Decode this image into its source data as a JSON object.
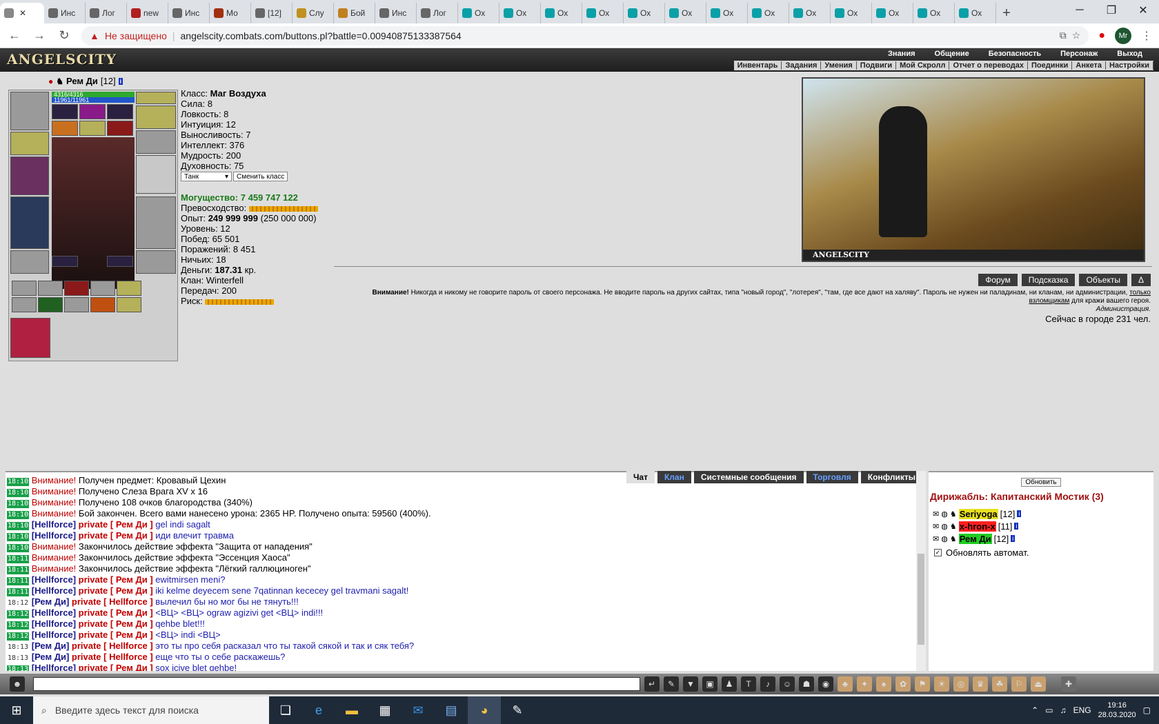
{
  "browser": {
    "tabs": [
      {
        "title": "",
        "color": "#888888",
        "active": true
      },
      {
        "title": "Инс",
        "color": "#666666"
      },
      {
        "title": "Лог",
        "color": "#666666"
      },
      {
        "title": "new",
        "color": "#b02020"
      },
      {
        "title": "Инс",
        "color": "#666666"
      },
      {
        "title": "Мо",
        "color": "#a03010"
      },
      {
        "title": "[12]",
        "color": "#666666"
      },
      {
        "title": "Слу",
        "color": "#c09020"
      },
      {
        "title": "Бой",
        "color": "#c08020"
      },
      {
        "title": "Инс",
        "color": "#666666"
      },
      {
        "title": "Лог",
        "color": "#666666"
      },
      {
        "title": "Ох",
        "color": "#0aa0a8"
      },
      {
        "title": "Ох",
        "color": "#0aa0a8"
      },
      {
        "title": "Ох",
        "color": "#0aa0a8"
      },
      {
        "title": "Ох",
        "color": "#0aa0a8"
      },
      {
        "title": "Ох",
        "color": "#0aa0a8"
      },
      {
        "title": "Ох",
        "color": "#0aa0a8"
      },
      {
        "title": "Ох",
        "color": "#0aa0a8"
      },
      {
        "title": "Ох",
        "color": "#0aa0a8"
      },
      {
        "title": "Ох",
        "color": "#0aa0a8"
      },
      {
        "title": "Ох",
        "color": "#0aa0a8"
      },
      {
        "title": "Ох",
        "color": "#0aa0a8"
      },
      {
        "title": "Ох",
        "color": "#0aa0a8"
      },
      {
        "title": "Ох",
        "color": "#0aa0a8"
      }
    ],
    "security_label": "Не защищено",
    "url": "angelscity.combats.com/buttons.pl?battle=0.00940875133387564",
    "profile_initials": "Mr"
  },
  "game": {
    "logo": "ANGELSCITY",
    "top_menu": [
      "Знания",
      "Общение",
      "Безопасность",
      "Персонаж",
      "Выход"
    ],
    "sub_menu": [
      "Инвентарь",
      "Задания",
      "Умения",
      "Подвиги",
      "Мой Скролл",
      "Отчет о переводах",
      "Поединки",
      "Анкета",
      "Настройки"
    ]
  },
  "character": {
    "name": "Рем Ди",
    "level": "[12]",
    "hp": "4316/4316",
    "mp": "11961/11961",
    "class_label": "Класс:",
    "class_value": "Маг Воздуха",
    "stats": [
      "Сила: 8",
      "Ловкость: 8",
      "Интуиция: 12",
      "Выносливость: 7",
      "Интеллект: 376",
      "Мудрость: 200",
      "Духовность: 75"
    ],
    "role_select": "Танк",
    "change_class": "Сменить класс",
    "power": "Могущество: 7 459 747 122",
    "superiority": "Превосходство:",
    "exp_label": "Опыт:",
    "exp_value": "249 999 999",
    "exp_next": "(250 000 000)",
    "info": [
      "Уровень: 12",
      "Побед: 65 501",
      "Поражений: 8 451",
      "Ничьих: 18"
    ],
    "money_label": "Деньги:",
    "money_value": "187.31",
    "money_unit": "кр.",
    "clan": "Клан: Winterfell",
    "transfers": "Передач: 200",
    "risk": "Риск:"
  },
  "scene": {
    "label": "ANGELSCITY"
  },
  "right_buttons": [
    "Форум",
    "Подсказка",
    "Объекты",
    "Δ"
  ],
  "notice": {
    "bold": "Внимание!",
    "text1": " Никогда и никому не говорите пароль от своего персонажа. Не вводите пароль на других сайтах, типа \"новый город\", \"лотерея\", \"там, где все дают на халяву\". Пароль не нужен ни паладинам, ни кланам, ни администрации, ",
    "link": "только взломщикам",
    "text2": " для кражи вашего героя.",
    "sign": "Администрация."
  },
  "online": "Сейчас в городе 231 чел.",
  "chat_tabs": [
    "Чат",
    "Клан",
    "Системные сообщения",
    "Торговля",
    "Конфликты"
  ],
  "chat": [
    {
      "time": "18:10",
      "type": "att",
      "lead": "Внимание!",
      "text": " Получен предмет: Кровавый Цехин"
    },
    {
      "time": "18:10",
      "type": "att",
      "lead": "Внимание!",
      "text": " Получено Слеза Врага XV x 16"
    },
    {
      "time": "18:10",
      "type": "att",
      "lead": "Внимание!",
      "text": " Получено 108 очков благородства (340%)"
    },
    {
      "time": "18:10",
      "type": "att",
      "lead": "Внимание!",
      "text": " Бой закончен. Всего вами нанесено урона: 2365 HP. Получено опыта: 59560 (400%)."
    },
    {
      "time": "18:10",
      "type": "priv",
      "from": "[Hellforce]",
      "to": "private [ Рем Ди ]",
      "text": "gel indi sagalt"
    },
    {
      "time": "18:10",
      "type": "priv",
      "from": "[Hellforce]",
      "to": "private [ Рем Ди ]",
      "text": "иди влечит травма"
    },
    {
      "time": "18:10",
      "type": "att",
      "lead": "Внимание!",
      "text": " Закончилось действие эффекта \"Защита от нападения\""
    },
    {
      "time": "18:11",
      "type": "att",
      "lead": "Внимание!",
      "text": " Закончилось действие эффекта \"Эссенция Хаоса\""
    },
    {
      "time": "18:11",
      "type": "att",
      "lead": "Внимание!",
      "text": " Закончилось действие эффекта \"Лёгкий галлюциноген\""
    },
    {
      "time": "18:11",
      "type": "priv",
      "from": "[Hellforce]",
      "to": "private [ Рем Ди ]",
      "text": "ewitmirsen meni?"
    },
    {
      "time": "18:11",
      "type": "priv",
      "from": "[Hellforce]",
      "to": "private [ Рем Ди ]",
      "text": "iki kelme deyecem sene 7qatinnan kececey gel travmani sagalt!"
    },
    {
      "time": "18:12",
      "type": "privw",
      "from": "[Рем Ди]",
      "to": "private [ Hellforce ]",
      "text": "вылечил бы но мог бы не тянуть!!!"
    },
    {
      "time": "18:12",
      "type": "priv",
      "from": "[Hellforce]",
      "to": "private [ Рем Ди ]",
      "text": "<ВЦ> <ВЦ> ograw agizivi get <ВЦ> indi!!!"
    },
    {
      "time": "18:12",
      "type": "priv",
      "from": "[Hellforce]",
      "to": "private [ Рем Ди ]",
      "text": "qehbe blet!!!"
    },
    {
      "time": "18:12",
      "type": "priv",
      "from": "[Hellforce]",
      "to": "private [ Рем Ди ]",
      "text": "<ВЦ> indi <ВЦ>"
    },
    {
      "time": "18:13",
      "type": "privw",
      "from": "[Рем Ди]",
      "to": "private [ Hellforce ]",
      "text": "это ты про себя расказал что ты такой сякой и так и сяк тебя?"
    },
    {
      "time": "18:13",
      "type": "privw",
      "from": "[Рем Ди]",
      "to": "private [ Hellforce ]",
      "text": "еще что ты о себе раскажешь?"
    },
    {
      "time": "18:13",
      "type": "priv",
      "from": "[Hellforce]",
      "to": "private [ Рем Ди ]",
      "text": "sox icive blet qehbe!"
    }
  ],
  "room": {
    "refresh": "Обновить",
    "title": "Дирижабль: Капитанский Мостик (3)",
    "users": [
      {
        "name": "Seriyoga",
        "level": "[12]",
        "bg": "#e8e020",
        "fg": "#000000"
      },
      {
        "name": "x-hron-x",
        "level": "[11]",
        "bg": "#ff2020",
        "fg": "#000000"
      },
      {
        "name": "Рем Ди",
        "level": "[12]",
        "bg": "#22cc22",
        "fg": "#000000"
      }
    ],
    "auto_refresh": "Обновлять автомат."
  },
  "taskbar": {
    "search_placeholder": "Введите здесь текст для поиска",
    "lang": "ENG",
    "time": "19:16",
    "date": "28.03.2020"
  }
}
